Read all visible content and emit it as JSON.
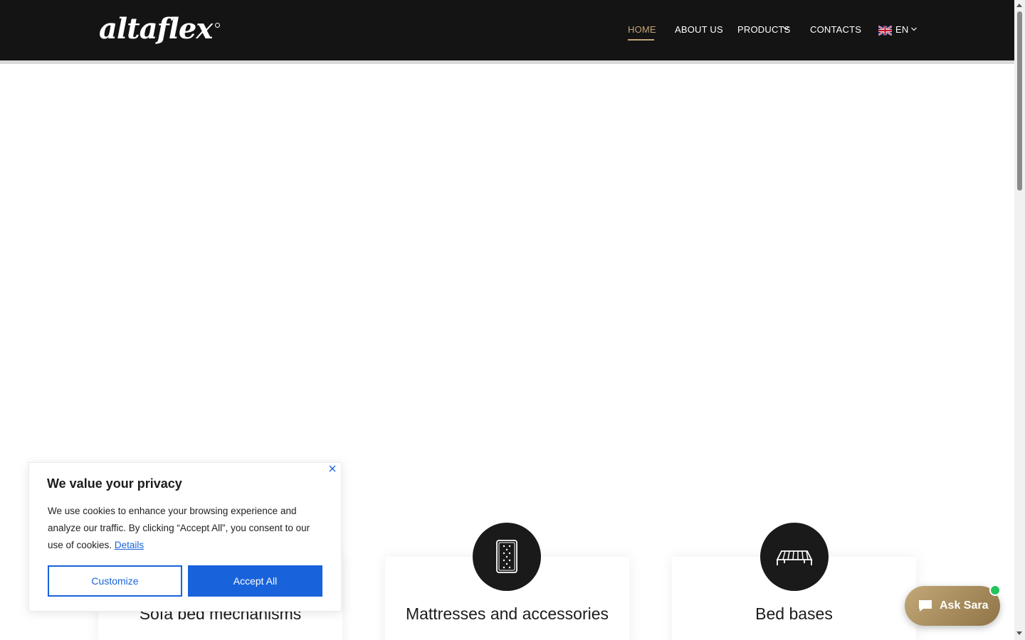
{
  "header": {
    "logo_text": "altaflex",
    "nav": [
      {
        "label": "HOME",
        "active": true
      },
      {
        "label": "ABOUT US"
      },
      {
        "label": "PRODUCTS"
      },
      {
        "label": "CONTACTS"
      }
    ],
    "language": {
      "label": "EN",
      "flag_icon": "uk-flag-icon"
    }
  },
  "colors": {
    "header_bg": "#141414",
    "accent": "#c4a47a",
    "cookie_blue": "#1863dc",
    "chat_gold": "#b09466",
    "online_green": "#22c55e"
  },
  "categories": [
    {
      "title": "Sofa bed mechanisms",
      "icon": "sofa-bed-mechanism-icon"
    },
    {
      "title": "Mattresses and accessories",
      "icon": "mattress-icon"
    },
    {
      "title": "Bed bases",
      "icon": "bed-base-icon"
    }
  ],
  "cookie_banner": {
    "title": "We value your privacy",
    "text": "We use cookies to enhance your browsing experience and analyze our traffic. By clicking “Accept All”, you consent to our use of cookies.",
    "details_link": "Details",
    "customize_label": "Customize",
    "accept_label": "Accept All"
  },
  "chat": {
    "label": "Ask Sara"
  }
}
